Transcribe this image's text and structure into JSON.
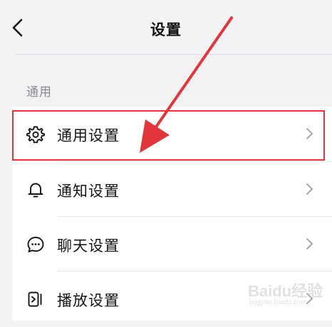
{
  "header": {
    "title": "设置",
    "back_icon": "chevron-left-icon"
  },
  "section": {
    "label": "通用"
  },
  "items": [
    {
      "label": "通用设置",
      "icon": "gear-icon",
      "highlighted": true
    },
    {
      "label": "通知设置",
      "icon": "bell-icon"
    },
    {
      "label": "聊天设置",
      "icon": "chat-bubble-icon"
    },
    {
      "label": "播放设置",
      "icon": "play-settings-icon"
    }
  ],
  "annotation": {
    "color": "#e2353b"
  },
  "watermark": {
    "brand": "Baidu经验",
    "url": "jingyan.baidu.com"
  }
}
